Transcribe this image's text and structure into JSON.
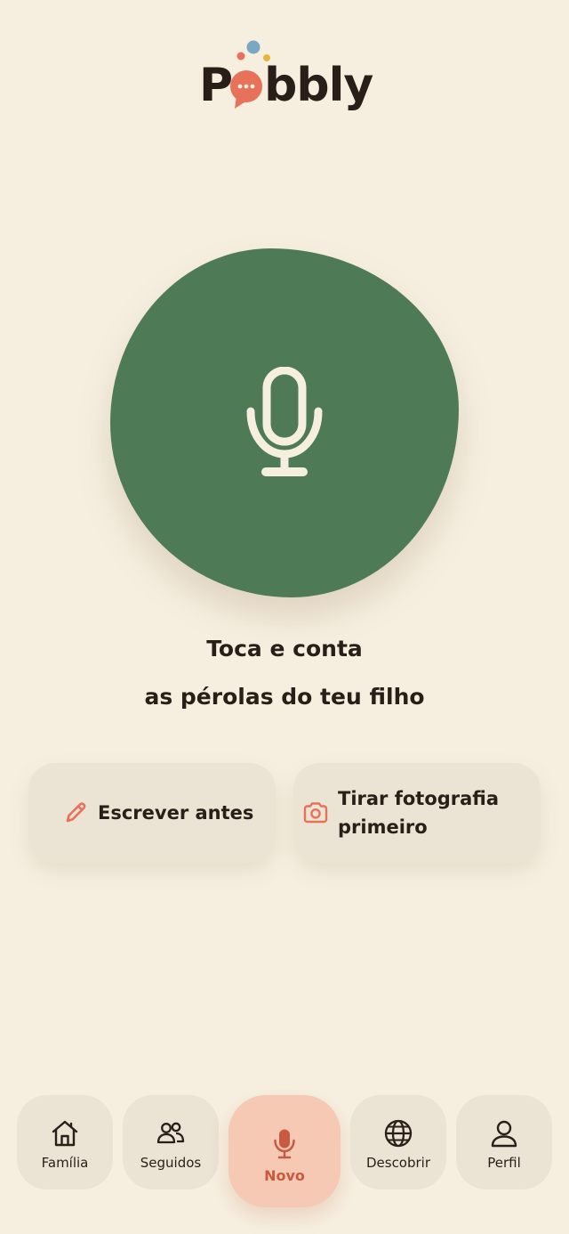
{
  "app": {
    "logo_text": "Pobbly"
  },
  "record": {
    "prompt_line1": "Toca e conta",
    "prompt_line2": "as pérolas do teu filho",
    "icon": "microphone-icon"
  },
  "options": [
    {
      "label": "Escrever antes",
      "icon": "pencil-icon"
    },
    {
      "label": "Tirar fotografia primeiro",
      "icon": "camera-icon"
    }
  ],
  "nav": {
    "items": [
      {
        "label": "Família",
        "icon": "home-icon"
      },
      {
        "label": "Seguidos",
        "icon": "users-icon"
      },
      {
        "label": "Novo",
        "icon": "microphone-icon",
        "active": true
      },
      {
        "label": "Descobrir",
        "icon": "globe-icon"
      },
      {
        "label": "Perfil",
        "icon": "user-icon"
      }
    ]
  },
  "colors": {
    "background": "#f6efe0",
    "record_green": "#4e7b56",
    "accent_coral": "#e8715a",
    "card": "#ebe3d4",
    "active_nav": "#f5c9b4",
    "text": "#2a1e18"
  }
}
